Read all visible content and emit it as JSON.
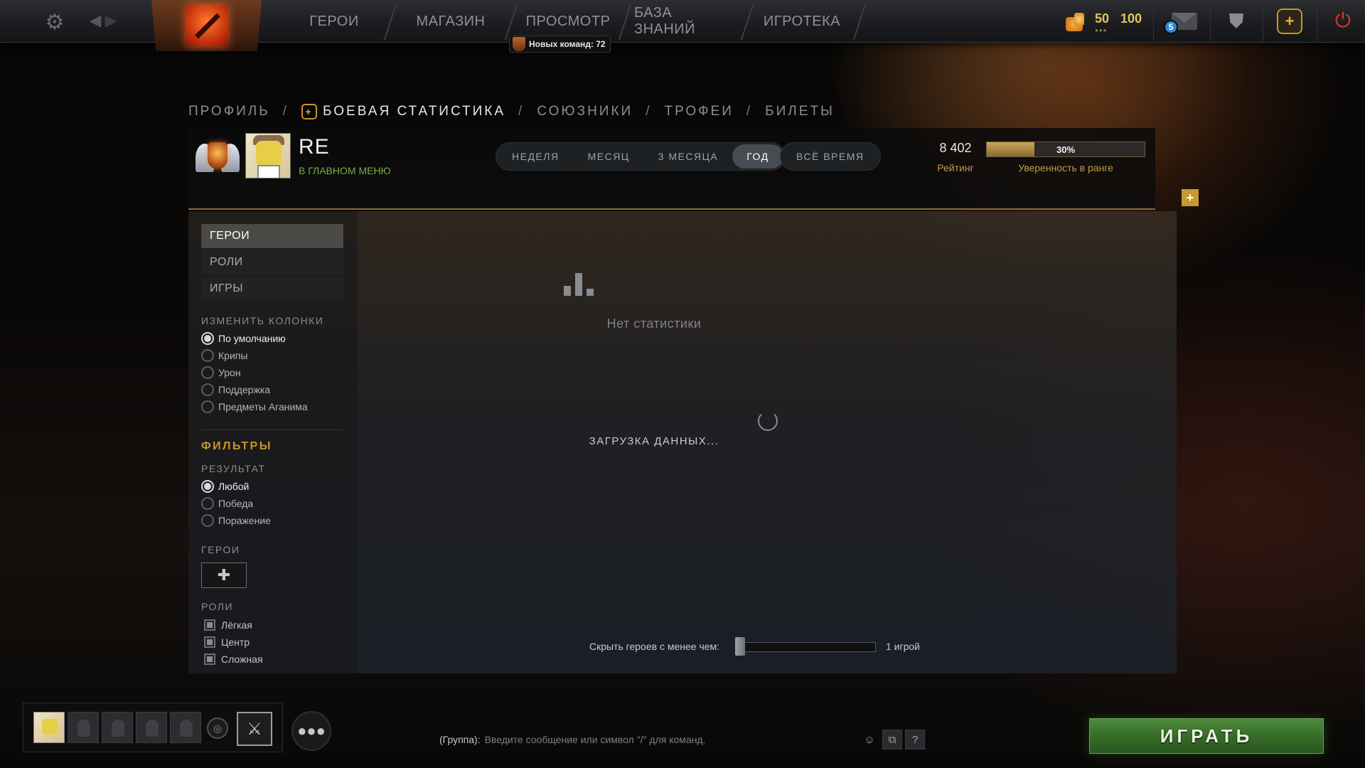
{
  "topbar": {
    "nav": [
      "ГЕРОИ",
      "МАГАЗИН",
      "ПРОСМОТР",
      "БАЗА ЗНАНИЙ",
      "ИГРОТЕКА"
    ],
    "new_commands_badge": "Новых команд: 72",
    "shards_a": "50",
    "shards_b": "100",
    "mail_count": "5"
  },
  "breadcrumb": {
    "profile": "ПРОФИЛЬ",
    "stats": "БОЕВАЯ СТАТИСТИКА",
    "allies": "СОЮЗНИКИ",
    "trophies": "ТРОФЕИ",
    "tickets": "БИЛЕТЫ",
    "sep": "/"
  },
  "profile": {
    "name": "RE",
    "status": "В ГЛАВНОМ МЕНЮ",
    "periods": [
      "НЕДЕЛЯ",
      "МЕСЯЦ",
      "3 МЕСЯЦА",
      "ГОД"
    ],
    "active_period": "ГОД",
    "all_time": "ВСЁ ВРЕМЯ",
    "rating_value": "8 402",
    "rating_label": "Рейтинг",
    "confidence_pct": "30%",
    "confidence_fraction": 0.3,
    "confidence_label": "Уверенность в ранге"
  },
  "sidebar": {
    "tabs": [
      "ГЕРОИ",
      "РОЛИ",
      "ИГРЫ"
    ],
    "columns_title": "ИЗМЕНИТЬ КОЛОНКИ",
    "columns": [
      "По умолчанию",
      "Крипы",
      "Урон",
      "Поддержка",
      "Предметы Аганима"
    ],
    "filters_title": "ФИЛЬТРЫ",
    "result_title": "РЕЗУЛЬТАТ",
    "results": [
      "Любой",
      "Победа",
      "Поражение"
    ],
    "heroes_title": "ГЕРОИ",
    "add_hero": "✚",
    "roles_title": "РОЛИ",
    "roles": [
      "Лёгкая",
      "Центр",
      "Сложная"
    ]
  },
  "content": {
    "no_stats": "Нет статистики",
    "loading": "ЗАГРУЗКА ДАННЫХ...",
    "hide_label": "Скрыть героев с менее чем:",
    "hide_value": "1 игрой"
  },
  "bottom": {
    "chat_prefix": "(Группа):",
    "chat_placeholder": "Введите сообщение или символ \"/\" для команд.",
    "help": "?",
    "play": "ИГРАТЬ"
  },
  "icons": {
    "gear": "settings-gear-icon",
    "back": "back-arrow-icon",
    "forward": "forward-arrow-icon",
    "mail": "mail-icon",
    "armory": "armory-icon",
    "plus": "dota-plus-icon",
    "power": "power-icon",
    "voice": "headset-icon",
    "friends": "friends-icon",
    "emoji": "smiley-icon",
    "screenshot": "screenshot-icon"
  },
  "colors": {
    "accent_gold": "#c8952c",
    "status_green": "#75b043",
    "play_green": "#376d28"
  }
}
